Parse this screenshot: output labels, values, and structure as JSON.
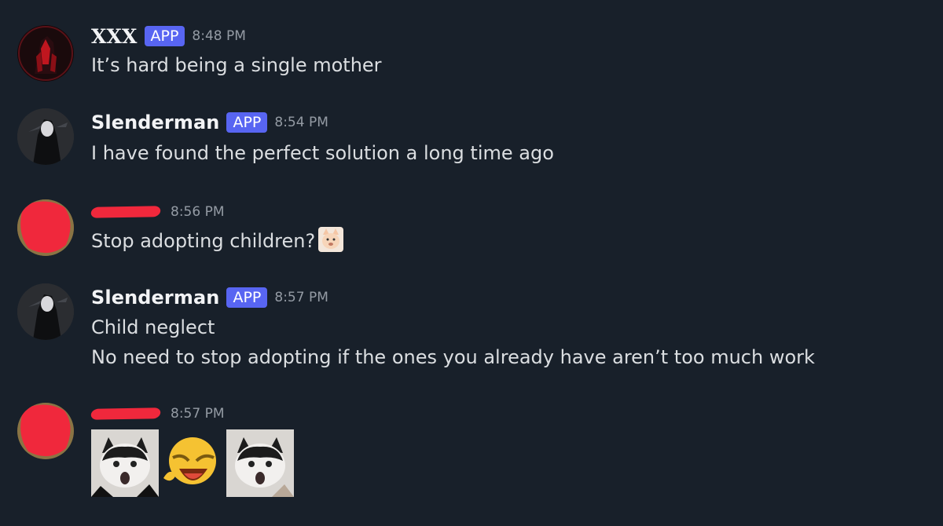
{
  "messages": [
    {
      "author": "XXX",
      "badge": "APP",
      "time": "8:48 PM",
      "lines": [
        "It’s hard being a single mother"
      ]
    },
    {
      "author": "Slenderman",
      "badge": "APP",
      "time": "8:54 PM",
      "lines": [
        "I have found the perfect solution a long time ago"
      ]
    },
    {
      "author": "",
      "time": "8:56 PM",
      "lines": [
        "Stop adopting children?"
      ],
      "emoji": "cat-emoji"
    },
    {
      "author": "Slenderman",
      "badge": "APP",
      "time": "8:57 PM",
      "lines": [
        "Child neglect",
        "No need to stop adopting if the ones you already have aren’t too much work"
      ]
    },
    {
      "author": "",
      "time": "8:57 PM",
      "attachments": [
        "cat-sticker",
        "laughing-emoji",
        "cat-sticker"
      ]
    }
  ],
  "colors": {
    "background": "#18202a",
    "badge": "#5865f2",
    "redaction": "#f0283c",
    "text": "#dbdee1",
    "timestamp": "#949ba4"
  }
}
